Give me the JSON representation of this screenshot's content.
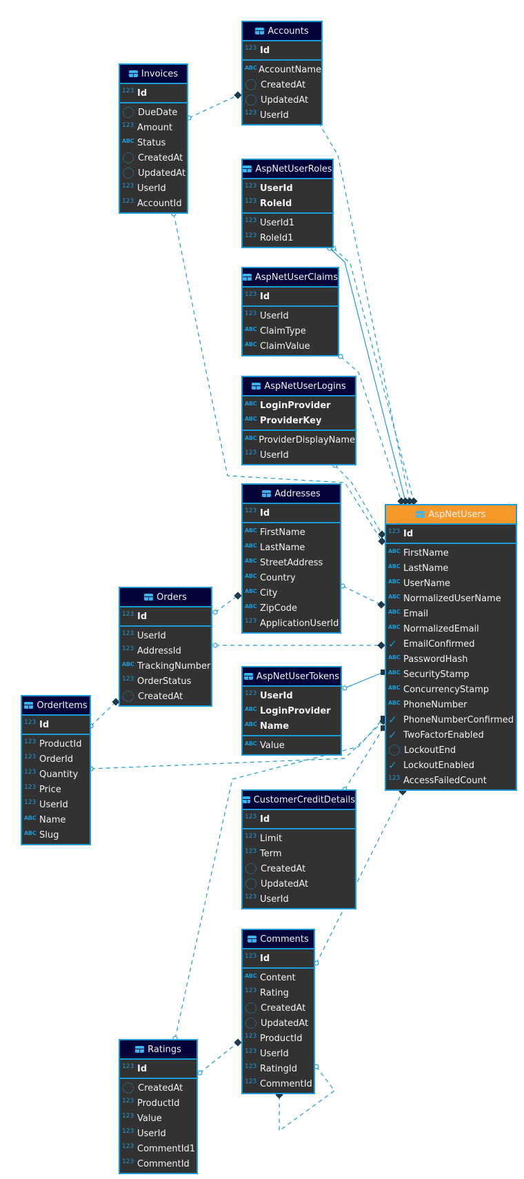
{
  "diagram": {
    "entities": [
      {
        "id": "Accounts",
        "title": "Accounts",
        "keys": [
          {
            "name": "Id",
            "type": "123"
          }
        ],
        "cols": [
          {
            "name": "AccountName",
            "type": "abc"
          },
          {
            "name": "CreatedAt",
            "type": "date"
          },
          {
            "name": "UpdatedAt",
            "type": "date"
          },
          {
            "name": "UserId",
            "type": "123"
          }
        ]
      },
      {
        "id": "Invoices",
        "title": "Invoices",
        "keys": [
          {
            "name": "Id",
            "type": "123"
          }
        ],
        "cols": [
          {
            "name": "DueDate",
            "type": "date"
          },
          {
            "name": "Amount",
            "type": "123"
          },
          {
            "name": "Status",
            "type": "abc"
          },
          {
            "name": "CreatedAt",
            "type": "date"
          },
          {
            "name": "UpdatedAt",
            "type": "date"
          },
          {
            "name": "UserId",
            "type": "123"
          },
          {
            "name": "AccountId",
            "type": "123"
          }
        ]
      },
      {
        "id": "AspNetUserRoles",
        "title": "AspNetUserRoles",
        "keys": [
          {
            "name": "UserId",
            "type": "123"
          },
          {
            "name": "RoleId",
            "type": "123"
          }
        ],
        "cols": [
          {
            "name": "UserId1",
            "type": "123"
          },
          {
            "name": "RoleId1",
            "type": "123"
          }
        ]
      },
      {
        "id": "AspNetUserClaims",
        "title": "AspNetUserClaims",
        "keys": [
          {
            "name": "Id",
            "type": "123"
          }
        ],
        "cols": [
          {
            "name": "UserId",
            "type": "123"
          },
          {
            "name": "ClaimType",
            "type": "abc"
          },
          {
            "name": "ClaimValue",
            "type": "abc"
          }
        ]
      },
      {
        "id": "AspNetUserLogins",
        "title": "AspNetUserLogins",
        "keys": [
          {
            "name": "LoginProvider",
            "type": "abc"
          },
          {
            "name": "ProviderKey",
            "type": "abc"
          }
        ],
        "cols": [
          {
            "name": "ProviderDisplayName",
            "type": "abc"
          },
          {
            "name": "UserId",
            "type": "123"
          }
        ]
      },
      {
        "id": "Addresses",
        "title": "Addresses",
        "keys": [
          {
            "name": "Id",
            "type": "123"
          }
        ],
        "cols": [
          {
            "name": "FirstName",
            "type": "abc"
          },
          {
            "name": "LastName",
            "type": "abc"
          },
          {
            "name": "StreetAddress",
            "type": "abc"
          },
          {
            "name": "Country",
            "type": "abc"
          },
          {
            "name": "City",
            "type": "abc"
          },
          {
            "name": "ZipCode",
            "type": "abc"
          },
          {
            "name": "ApplicationUserId",
            "type": "123"
          }
        ]
      },
      {
        "id": "Orders",
        "title": "Orders",
        "keys": [
          {
            "name": "Id",
            "type": "123"
          }
        ],
        "cols": [
          {
            "name": "UserId",
            "type": "123"
          },
          {
            "name": "AddressId",
            "type": "123"
          },
          {
            "name": "TrackingNumber",
            "type": "abc"
          },
          {
            "name": "OrderStatus",
            "type": "123"
          },
          {
            "name": "CreatedAt",
            "type": "date"
          }
        ]
      },
      {
        "id": "OrderItems",
        "title": "OrderItems",
        "keys": [
          {
            "name": "Id",
            "type": "123"
          }
        ],
        "cols": [
          {
            "name": "ProductId",
            "type": "123"
          },
          {
            "name": "OrderId",
            "type": "123"
          },
          {
            "name": "Quantity",
            "type": "123"
          },
          {
            "name": "Price",
            "type": "123"
          },
          {
            "name": "UserId",
            "type": "123"
          },
          {
            "name": "Name",
            "type": "abc"
          },
          {
            "name": "Slug",
            "type": "abc"
          }
        ]
      },
      {
        "id": "AspNetUserTokens",
        "title": "AspNetUserTokens",
        "keys": [
          {
            "name": "UserId",
            "type": "123"
          },
          {
            "name": "LoginProvider",
            "type": "abc"
          },
          {
            "name": "Name",
            "type": "abc"
          }
        ],
        "cols": [
          {
            "name": "Value",
            "type": "abc"
          }
        ]
      },
      {
        "id": "AspNetUsers",
        "title": "AspNetUsers",
        "main": true,
        "keys": [
          {
            "name": "Id",
            "type": "123"
          }
        ],
        "cols": [
          {
            "name": "FirstName",
            "type": "abc"
          },
          {
            "name": "LastName",
            "type": "abc"
          },
          {
            "name": "UserName",
            "type": "abc"
          },
          {
            "name": "NormalizedUserName",
            "type": "abc"
          },
          {
            "name": "Email",
            "type": "abc"
          },
          {
            "name": "NormalizedEmail",
            "type": "abc"
          },
          {
            "name": "EmailConfirmed",
            "type": "bool"
          },
          {
            "name": "PasswordHash",
            "type": "abc"
          },
          {
            "name": "SecurityStamp",
            "type": "abc"
          },
          {
            "name": "ConcurrencyStamp",
            "type": "abc"
          },
          {
            "name": "PhoneNumber",
            "type": "abc"
          },
          {
            "name": "PhoneNumberConfirmed",
            "type": "bool"
          },
          {
            "name": "TwoFactorEnabled",
            "type": "bool"
          },
          {
            "name": "LockoutEnd",
            "type": "date"
          },
          {
            "name": "LockoutEnabled",
            "type": "bool"
          },
          {
            "name": "AccessFailedCount",
            "type": "123"
          }
        ]
      },
      {
        "id": "CustomerCreditDetails",
        "title": "CustomerCreditDetails",
        "keys": [
          {
            "name": "Id",
            "type": "123"
          }
        ],
        "cols": [
          {
            "name": "Limit",
            "type": "123"
          },
          {
            "name": "Term",
            "type": "123"
          },
          {
            "name": "CreatedAt",
            "type": "date"
          },
          {
            "name": "UpdatedAt",
            "type": "date"
          },
          {
            "name": "UserId",
            "type": "123"
          }
        ]
      },
      {
        "id": "Comments",
        "title": "Comments",
        "keys": [
          {
            "name": "Id",
            "type": "123"
          }
        ],
        "cols": [
          {
            "name": "Content",
            "type": "abc"
          },
          {
            "name": "Rating",
            "type": "123"
          },
          {
            "name": "CreatedAt",
            "type": "date"
          },
          {
            "name": "UpdatedAt",
            "type": "date"
          },
          {
            "name": "ProductId",
            "type": "123"
          },
          {
            "name": "UserId",
            "type": "123"
          },
          {
            "name": "RatingId",
            "type": "123"
          },
          {
            "name": "CommentId",
            "type": "123"
          }
        ]
      },
      {
        "id": "Ratings",
        "title": "Ratings",
        "keys": [
          {
            "name": "Id",
            "type": "123"
          }
        ],
        "cols": [
          {
            "name": "CreatedAt",
            "type": "date"
          },
          {
            "name": "ProductId",
            "type": "123"
          },
          {
            "name": "Value",
            "type": "123"
          },
          {
            "name": "UserId",
            "type": "123"
          },
          {
            "name": "CommentId1",
            "type": "123"
          },
          {
            "name": "CommentId",
            "type": "123"
          }
        ]
      }
    ],
    "type_icons": {
      "123": "123",
      "abc": "ABC",
      "date": "clock-dotted-icon",
      "bool": "✓"
    },
    "colors": {
      "accent": "#1a9bd7",
      "header": "#03033a",
      "main_header": "#f7982a",
      "body": "#323232",
      "text": "#f2f2f2"
    },
    "relations": [
      {
        "from": "Invoices",
        "to": "Accounts",
        "style": "dashed"
      },
      {
        "from": "Accounts",
        "to": "AspNetUsers",
        "style": "dashed"
      },
      {
        "from": "AspNetUserRoles",
        "to": "AspNetUsers",
        "style": "solid"
      },
      {
        "from": "AspNetUserRoles",
        "to": "AspNetUsers",
        "style": "dashed"
      },
      {
        "from": "AspNetUserClaims",
        "to": "AspNetUsers",
        "style": "dashed"
      },
      {
        "from": "AspNetUserLogins",
        "to": "AspNetUsers",
        "style": "dashed"
      },
      {
        "from": "Invoices",
        "to": "AspNetUsers",
        "style": "dashed"
      },
      {
        "from": "Addresses",
        "to": "AspNetUsers",
        "style": "dashed"
      },
      {
        "from": "Orders",
        "to": "Addresses",
        "style": "dashed"
      },
      {
        "from": "Orders",
        "to": "AspNetUsers",
        "style": "dashed"
      },
      {
        "from": "AspNetUserTokens",
        "to": "AspNetUsers",
        "style": "solid"
      },
      {
        "from": "OrderItems",
        "to": "Orders",
        "style": "dashed"
      },
      {
        "from": "OrderItems",
        "to": "AspNetUsers",
        "style": "dashed"
      },
      {
        "from": "CustomerCreditDetails",
        "to": "AspNetUsers",
        "style": "dashed"
      },
      {
        "from": "Ratings",
        "to": "AspNetUsers",
        "style": "dashed"
      },
      {
        "from": "Comments",
        "to": "AspNetUsers",
        "style": "dashed"
      },
      {
        "from": "Ratings",
        "to": "Comments",
        "style": "dashed"
      },
      {
        "from": "Comments",
        "to": "Comments",
        "style": "dashed"
      }
    ]
  }
}
